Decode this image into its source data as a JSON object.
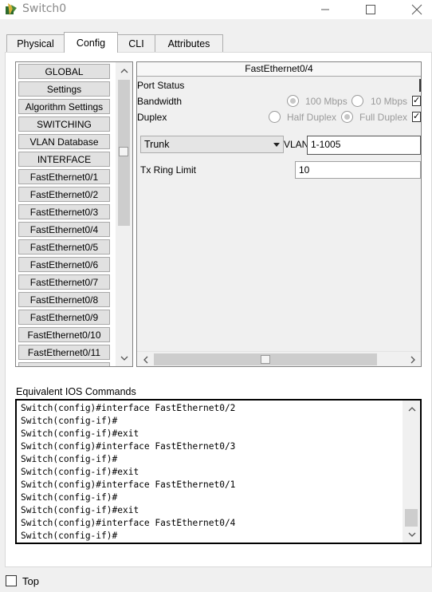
{
  "window": {
    "title": "Switch0",
    "controls": {
      "minimize_icon": "minimize-icon",
      "maximize_icon": "maximize-icon",
      "close_icon": "close-icon"
    }
  },
  "tabs": [
    {
      "label": "Physical",
      "active": false
    },
    {
      "label": "Config",
      "active": true
    },
    {
      "label": "CLI",
      "active": false
    },
    {
      "label": "Attributes",
      "active": false
    }
  ],
  "sidebar": {
    "items": [
      {
        "label": "GLOBAL"
      },
      {
        "label": "Settings"
      },
      {
        "label": "Algorithm Settings"
      },
      {
        "label": "SWITCHING"
      },
      {
        "label": "VLAN Database"
      },
      {
        "label": "INTERFACE"
      },
      {
        "label": "FastEthernet0/1"
      },
      {
        "label": "FastEthernet0/2"
      },
      {
        "label": "FastEthernet0/3"
      },
      {
        "label": "FastEthernet0/4"
      },
      {
        "label": "FastEthernet0/5"
      },
      {
        "label": "FastEthernet0/6"
      },
      {
        "label": "FastEthernet0/7"
      },
      {
        "label": "FastEthernet0/8"
      },
      {
        "label": "FastEthernet0/9"
      },
      {
        "label": "FastEthernet0/10"
      },
      {
        "label": "FastEthernet0/11"
      }
    ]
  },
  "panel": {
    "title": "FastEthernet0/4",
    "port_status_label": "Port Status",
    "bandwidth_label": "Bandwidth",
    "bandwidth_options": [
      "100 Mbps",
      "10 Mbps"
    ],
    "bandwidth_selected": "100 Mbps",
    "duplex_label": "Duplex",
    "duplex_options": [
      "Half Duplex",
      "Full Duplex"
    ],
    "duplex_selected": "Full Duplex",
    "mode_value": "Trunk",
    "vlan_label": "VLAN",
    "vlan_value": "1-1005",
    "tx_ring_label": "Tx Ring Limit",
    "tx_ring_value": "10"
  },
  "ios": {
    "label": "Equivalent IOS Commands",
    "lines": [
      "Switch(config)#interface FastEthernet0/2",
      "Switch(config-if)#",
      "Switch(config-if)#exit",
      "Switch(config)#interface FastEthernet0/3",
      "Switch(config-if)#",
      "Switch(config-if)#exit",
      "Switch(config)#interface FastEthernet0/1",
      "Switch(config-if)#",
      "Switch(config-if)#exit",
      "Switch(config)#interface FastEthernet0/4",
      "Switch(config-if)#"
    ]
  },
  "footer": {
    "top_label": "Top",
    "top_checked": false
  }
}
